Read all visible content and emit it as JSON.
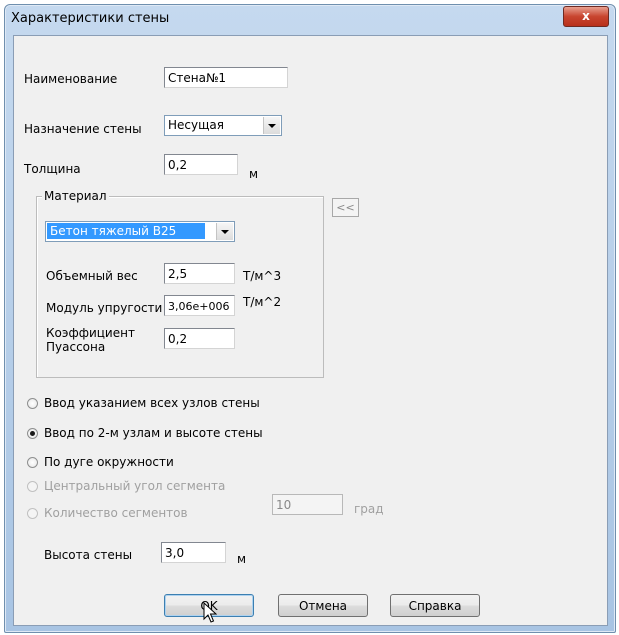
{
  "window": {
    "title": "Характеристики стены",
    "close_label": "x"
  },
  "form": {
    "name_label": "Наименование",
    "name_value": "Стена№1",
    "purpose_label": "Назначение стены",
    "purpose_value": "Несущая",
    "thickness_label": "Толщина",
    "thickness_value": "0,2",
    "thickness_unit": "м"
  },
  "material": {
    "group_title": "Материал",
    "collapse_label": "<<",
    "selected": "Бетон тяжелый B25",
    "density_label": "Объемный вес",
    "density_value": "2,5",
    "density_unit": "Т/м^3",
    "modulus_label": "Модуль упругости",
    "modulus_value": "3,06e+006",
    "modulus_unit": "Т/м^2",
    "poisson_label_line1": "Коэффициент",
    "poisson_label_line2": "Пуассона",
    "poisson_value": "0,2"
  },
  "input_mode": {
    "options": [
      {
        "label": "Ввод указанием всех узлов стены",
        "checked": false,
        "enabled": true
      },
      {
        "label": "Ввод по 2-м узлам и высоте стены",
        "checked": true,
        "enabled": true
      },
      {
        "label": "По дуге окружности",
        "checked": false,
        "enabled": true
      },
      {
        "label": "Центральный угол сегмента",
        "checked": false,
        "enabled": false
      },
      {
        "label": "Количество сегментов",
        "checked": false,
        "enabled": false
      }
    ],
    "angle_value": "10",
    "angle_unit": "град"
  },
  "height": {
    "label": "Высота стены",
    "value": "3,0",
    "unit": "м"
  },
  "buttons": {
    "ok": "OK",
    "cancel": "Отмена",
    "help": "Справка"
  },
  "colors": {
    "selection": "#3399ff",
    "close_button": "#c8452f",
    "title_gradient": "#b9d1ea"
  }
}
